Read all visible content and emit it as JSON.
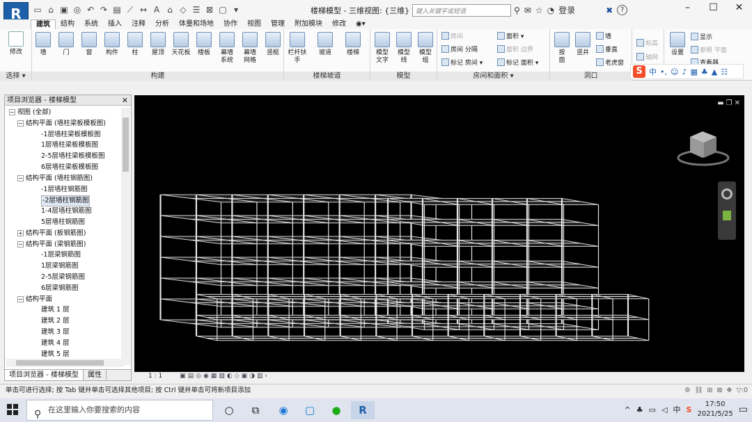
{
  "window": {
    "app_logo": "R",
    "doc_title": "楼梯模型 - 三维视图: {三维}",
    "search_placeholder": "键入关键字或短语",
    "login": "登录",
    "help": "?",
    "min": "–",
    "max": "☐",
    "close": "✕"
  },
  "tabs": [
    "建筑",
    "结构",
    "系统",
    "插入",
    "注释",
    "分析",
    "体量和场地",
    "协作",
    "视图",
    "管理",
    "附加模块",
    "修改"
  ],
  "active_tab": "建筑",
  "ribbon": {
    "select": {
      "label": "选择 ▾",
      "modify": "修改"
    },
    "build": {
      "label": "构建",
      "buttons": [
        "墙",
        "门",
        "窗",
        "构件",
        "柱",
        "屋顶",
        "天花板",
        "楼板",
        "幕墙\n系统",
        "幕墙\n网格",
        "竖梃"
      ]
    },
    "stairs": {
      "label": "楼梯坡道",
      "buttons": [
        "栏杆扶手",
        "坡道",
        "楼梯"
      ]
    },
    "model": {
      "label": "模型",
      "buttons": [
        "模型\n文字",
        "模型\n线",
        "模型\n组"
      ]
    },
    "room": {
      "label": "房间和面积 ▾",
      "items": [
        {
          "text": "房间",
          "dim": true
        },
        {
          "text": "房间 分隔",
          "dim": false
        },
        {
          "text": "标记 房间 ▾",
          "dim": false
        },
        {
          "text": "面积 ▾",
          "dim": false
        },
        {
          "text": "面积 边界",
          "dim": true
        },
        {
          "text": "标记 面积 ▾",
          "dim": false
        }
      ]
    },
    "opening": {
      "label": "洞口",
      "buttons": [
        "按\n面",
        "竖井"
      ],
      "items": [
        "墙",
        "垂直",
        "老虎窗"
      ]
    },
    "datum": {
      "items": [
        "标高",
        "轴网"
      ]
    },
    "workplane": {
      "buttons": [
        "设置"
      ],
      "items": [
        "显示",
        "参照 平面",
        "查看器"
      ]
    }
  },
  "browser": {
    "title": "项目浏览器 - 楼梯模型",
    "close": "✕",
    "nodes": [
      {
        "text": "视图 (全部)",
        "level": 0,
        "exp": "−"
      },
      {
        "text": "结构平面 (墙柱梁板模板图)",
        "level": 1,
        "exp": "−"
      },
      {
        "text": "-1层墙柱梁板模板图",
        "level": 2
      },
      {
        "text": "1层墙柱梁板模板图",
        "level": 2
      },
      {
        "text": "2-5层墙柱梁板模板图",
        "level": 2
      },
      {
        "text": "6层墙柱梁板模板图",
        "level": 2
      },
      {
        "text": "结构平面 (墙柱钢筋图)",
        "level": 1,
        "exp": "−"
      },
      {
        "text": "-1层墙柱钢筋图",
        "level": 2
      },
      {
        "text": "-2层墙柱钢筋图",
        "level": 2,
        "selected": true
      },
      {
        "text": "1-4层墙柱钢筋图",
        "level": 2
      },
      {
        "text": "5层墙柱钢筋图",
        "level": 2
      },
      {
        "text": "结构平面 (板钢筋图)",
        "level": 1,
        "exp": "+"
      },
      {
        "text": "结构平面 (梁钢筋图)",
        "level": 1,
        "exp": "−"
      },
      {
        "text": "-1层梁钢筋图",
        "level": 2
      },
      {
        "text": "1层梁钢筋图",
        "level": 2
      },
      {
        "text": "2-5层梁钢筋图",
        "level": 2
      },
      {
        "text": "6层梁钢筋图",
        "level": 2
      },
      {
        "text": "结构平面",
        "level": 1,
        "exp": "−"
      },
      {
        "text": "建筑 1 层",
        "level": 2
      },
      {
        "text": "建筑 2 层",
        "level": 2
      },
      {
        "text": "建筑 3 层",
        "level": 2
      },
      {
        "text": "建筑 4 层",
        "level": 2
      },
      {
        "text": "建筑 5 层",
        "level": 2
      }
    ],
    "tabs": [
      "项目浏览器 - 楼梯模型",
      "属性"
    ]
  },
  "viewbar": {
    "scale": "1 : 1"
  },
  "status": {
    "text": "单击可进行选择; 按 Tab 键并单击可选择其他项目; 按 Ctrl 键并单击可将新项目添加",
    "filter": ":0"
  },
  "taskbar": {
    "search": "在这里输入你要搜索的内容",
    "time": "17:50",
    "date": "2021/5/25",
    "ime_lang": "中"
  }
}
